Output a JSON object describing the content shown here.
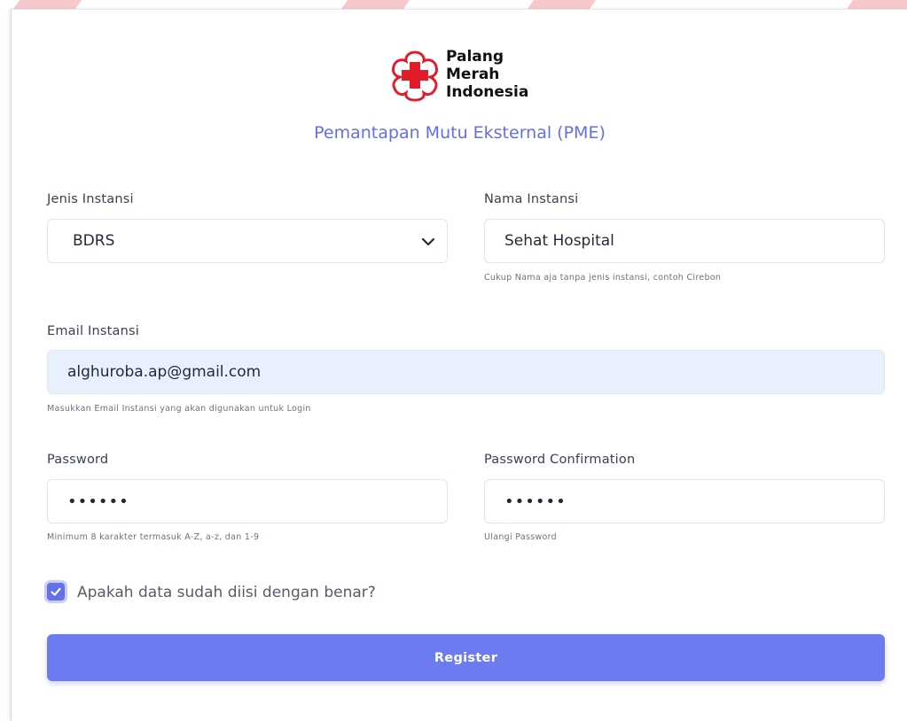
{
  "brand": {
    "line1": "Palang",
    "line2": "Merah",
    "line3": "Indonesia",
    "cross_color": "#e11d2a"
  },
  "subtitle": "Pemantapan Mutu Eksternal (PME)",
  "form": {
    "jenis_instansi": {
      "label": "Jenis Instansi",
      "value": "BDRS"
    },
    "nama_instansi": {
      "label": "Nama Instansi",
      "value": "Sehat Hospital",
      "hint": "Cukup Nama aja tanpa jenis instansi, contoh Cirebon"
    },
    "email_instansi": {
      "label": "Email Instansi",
      "value": "alghuroba.ap@gmail.com",
      "hint": "Masukkan Email Instansi yang akan digunakan untuk Login"
    },
    "password": {
      "label": "Password",
      "value": "••••••",
      "hint": "Minimum 8 karakter termasuk A-Z, a-z, dan 1-9"
    },
    "password_confirmation": {
      "label": "Password Confirmation",
      "value": "••••••",
      "hint": "Ulangi Password"
    },
    "confirm_checkbox": {
      "label": "Apakah data sudah diisi dengan benar?",
      "checked": true
    },
    "register_label": "Register"
  },
  "colors": {
    "accent": "#6c7bf0",
    "subtitle": "#6270e8",
    "autofill_bg": "#e8f0fe"
  }
}
